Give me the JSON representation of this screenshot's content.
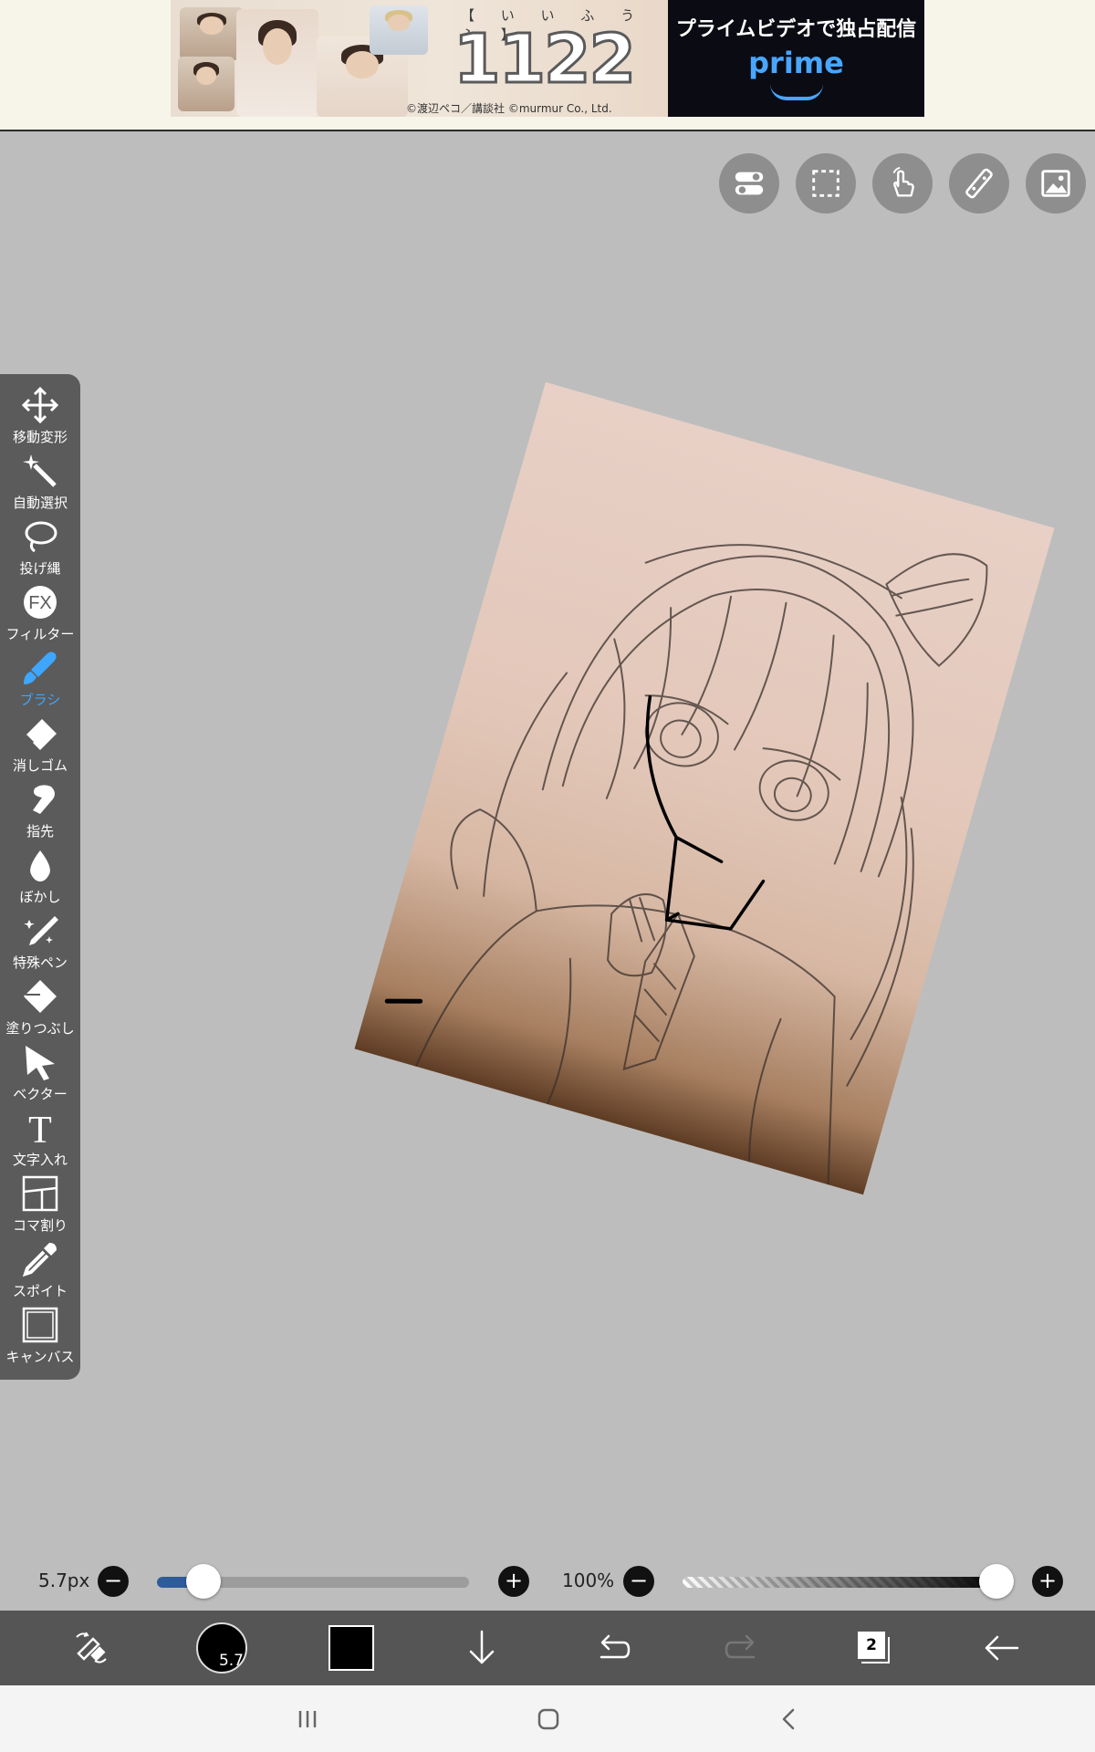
{
  "ad": {
    "title_small": "【 い い ふ う ふ 】",
    "title_big": "1122",
    "copyright": "©渡辺ペコ／講談社 ©murmur Co., Ltd.",
    "headline": "プライムビデオで独占配信",
    "brand": "prime"
  },
  "top_tools": [
    {
      "icon": "toggle-settings-icon"
    },
    {
      "icon": "selection-rect-icon"
    },
    {
      "icon": "touch-hand-icon"
    },
    {
      "icon": "ruler-icon"
    },
    {
      "icon": "image-icon"
    }
  ],
  "tools": [
    {
      "label": "移動変形",
      "icon": "move-transform-icon"
    },
    {
      "label": "自動選択",
      "icon": "magic-wand-icon"
    },
    {
      "label": "投げ縄",
      "icon": "lasso-icon"
    },
    {
      "label": "フィルター",
      "icon": "fx-filter-icon",
      "glyph": "FX"
    },
    {
      "label": "ブラシ",
      "icon": "brush-icon",
      "active": true
    },
    {
      "label": "消しゴム",
      "icon": "eraser-icon"
    },
    {
      "label": "指先",
      "icon": "finger-smudge-icon"
    },
    {
      "label": "ぼかし",
      "icon": "blur-drop-icon"
    },
    {
      "label": "特殊ペン",
      "icon": "special-pen-icon"
    },
    {
      "label": "塗りつぶし",
      "icon": "fill-bucket-icon"
    },
    {
      "label": "ベクター",
      "icon": "vector-arrow-icon"
    },
    {
      "label": "文字入れ",
      "icon": "text-icon",
      "glyph": "T"
    },
    {
      "label": "コマ割り",
      "icon": "panel-split-icon"
    },
    {
      "label": "スポイト",
      "icon": "eyedropper-icon"
    },
    {
      "label": "キャンバス",
      "icon": "canvas-icon"
    }
  ],
  "brush": {
    "size_text": "5.7px",
    "size_fraction": 0.15,
    "opacity_text": "100%",
    "opacity_fraction": 1.0,
    "minus": "−",
    "plus": "+"
  },
  "toolbar": {
    "brush_size_label": "5.7",
    "color": "#000000",
    "layer_count": "2"
  },
  "colors": {
    "accent": "#3ea6ff",
    "panel": "#5b5b5b",
    "canvas_bg": "#bdbdbd",
    "toolbar_bg": "#555555"
  }
}
